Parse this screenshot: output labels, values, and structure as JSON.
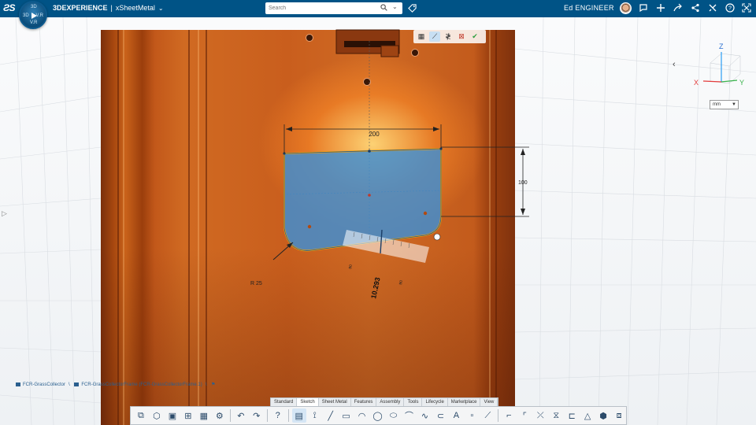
{
  "header": {
    "logo": "ƧS",
    "app_brand": "3DEXPERIENCE",
    "app_name": "xSheetMetal",
    "search_placeholder": "Search",
    "user_name": "Ed ENGINEER"
  },
  "compass": {
    "n": "3D",
    "w": "3D",
    "e": "V.R",
    "s": "V.R"
  },
  "sketch": {
    "dim_width": "200",
    "dim_height": "100",
    "dim_radius": "R 25",
    "dim_live": "10.293",
    "ruler_small_1": "90",
    "ruler_small_2": "90"
  },
  "triad": {
    "x": "X",
    "y": "Y",
    "z": "Z"
  },
  "units": {
    "value": "mm"
  },
  "breadcrumb": {
    "item1": "FCR-GrassCollector",
    "item2": "FCR-GrassCollectorFrame (FCR-GrassCollectorFrame.1)"
  },
  "tabs": [
    "Standard",
    "Sketch",
    "Sheet Metal",
    "Features",
    "Assembly",
    "Tools",
    "Lifecycle",
    "Marketplace",
    "View"
  ],
  "active_tab": "Sketch",
  "colors": {
    "topbar": "#005386",
    "sheet_metal": "#c95e1d",
    "sketch_fill": "#3d8fd6",
    "sketch_outline": "#f5a000"
  }
}
